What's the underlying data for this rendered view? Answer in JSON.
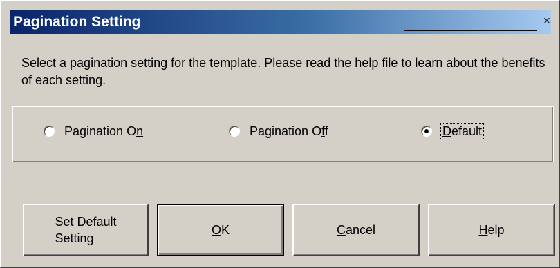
{
  "dialog": {
    "title": "Pagination Setting",
    "close_glyph": "×",
    "instruction": "Select a pagination setting for the template. Please read the help file to learn about the benefits of each setting."
  },
  "radios": [
    {
      "pre": "Pagination O",
      "key": "n",
      "post": "",
      "checked": false
    },
    {
      "pre": "Pagination O",
      "key": "f",
      "post": "f",
      "checked": false
    },
    {
      "pre": "",
      "key": "D",
      "post": "efault",
      "checked": true
    }
  ],
  "buttons": {
    "set_default": {
      "line1_pre": "Set ",
      "line1_key": "D",
      "line1_post": "efault",
      "line2": "Setting"
    },
    "ok": {
      "pre": "",
      "key": "O",
      "post": "K"
    },
    "cancel": {
      "pre": "",
      "key": "C",
      "post": "ancel"
    },
    "help": {
      "pre": "",
      "key": "H",
      "post": "elp"
    }
  },
  "colors": {
    "dialog_face": "#d4d0c8",
    "title_gradient_start": "#0a246a",
    "title_gradient_end": "#a6caf0",
    "title_text": "#ffffff"
  },
  "icons": {
    "close": "close-icon"
  }
}
